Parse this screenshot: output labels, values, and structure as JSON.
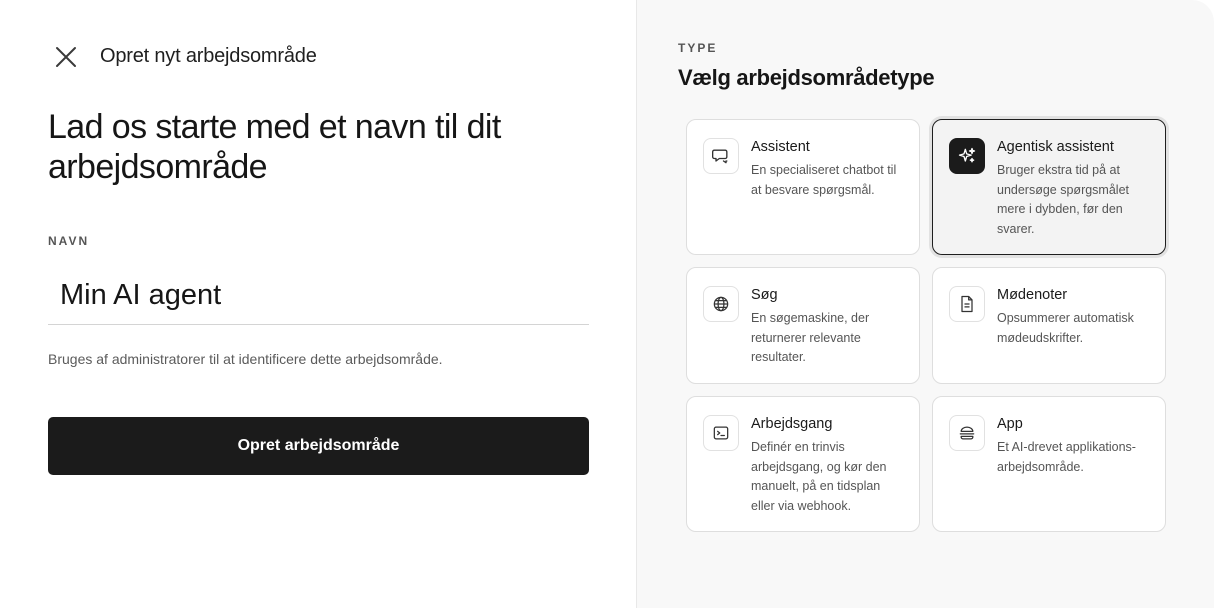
{
  "header": {
    "title": "Opret nyt arbejdsområde",
    "close_icon": "close-icon"
  },
  "form": {
    "headline": "Lad os starte med et navn til dit arbejdsområde",
    "name_label": "NAVN",
    "name_value": "Min AI agent",
    "helper_text": "Bruges af administratorer til at identificere dette arbejdsområde.",
    "submit_label": "Opret arbejdsområde"
  },
  "type_section": {
    "label": "TYPE",
    "title": "Vælg arbejdsområdetype",
    "options": [
      {
        "title": "Assistent",
        "description": "En specialiseret chatbot til at besvare spørgsmål.",
        "icon": "chat-icon",
        "selected": false
      },
      {
        "title": "Agentisk assistent",
        "description": "Bruger ekstra tid på at undersøge spørgsmålet mere i dybden, før den svarer.",
        "icon": "sparkles-icon",
        "selected": true
      },
      {
        "title": "Søg",
        "description": "En søgemaskine, der returnerer relevante resultater.",
        "icon": "globe-icon",
        "selected": false
      },
      {
        "title": "Mødenoter",
        "description": "Opsummerer automatisk mødeudskrifter.",
        "icon": "document-icon",
        "selected": false
      },
      {
        "title": "Arbejdsgang",
        "description": "Definér en trinvis arbejdsgang, og kør den manuelt, på en tidsplan eller via webhook.",
        "icon": "terminal-icon",
        "selected": false
      },
      {
        "title": "App",
        "description": "Et AI-drevet applikations-arbejdsområde.",
        "icon": "burger-icon",
        "selected": false
      }
    ]
  },
  "colors": {
    "primary_button": "#1b1b1b",
    "selected_border": "#1e1e1e",
    "right_pane_bg": "#f8f8f8"
  }
}
